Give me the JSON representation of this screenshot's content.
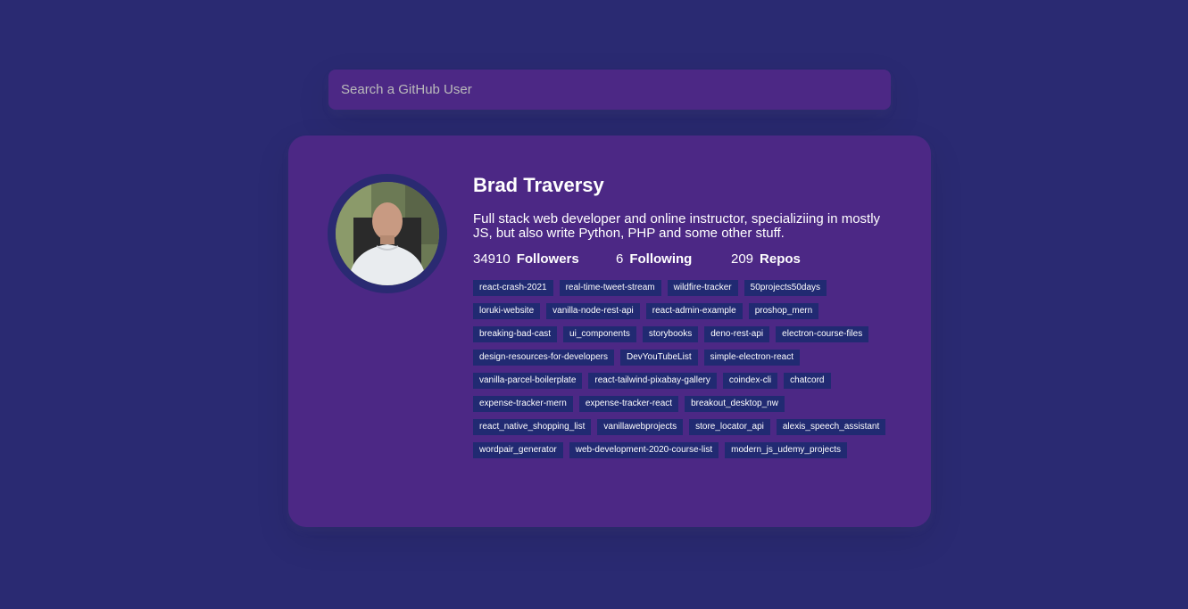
{
  "search": {
    "placeholder": "Search a GitHub User"
  },
  "profile": {
    "name": "Brad Traversy",
    "bio": "Full stack web developer and online instructor, specializiing in mostly JS, but also write Python, PHP and some other stuff.",
    "followers": {
      "count": "34910",
      "label": "Followers"
    },
    "following": {
      "count": "6",
      "label": "Following"
    },
    "repos": {
      "count": "209",
      "label": "Repos"
    }
  },
  "repos": [
    "react-crash-2021",
    "real-time-tweet-stream",
    "wildfire-tracker",
    "50projects50days",
    "loruki-website",
    "vanilla-node-rest-api",
    "react-admin-example",
    "proshop_mern",
    "breaking-bad-cast",
    "ui_components",
    "storybooks",
    "deno-rest-api",
    "electron-course-files",
    "design-resources-for-developers",
    "DevYouTubeList",
    "simple-electron-react",
    "vanilla-parcel-boilerplate",
    "react-tailwind-pixabay-gallery",
    "coindex-cli",
    "chatcord",
    "expense-tracker-mern",
    "expense-tracker-react",
    "breakout_desktop_nw",
    "react_native_shopping_list",
    "vanillawebprojects",
    "store_locator_api",
    "alexis_speech_assistant",
    "wordpair_generator",
    "web-development-2020-course-list",
    "modern_js_udemy_projects"
  ],
  "colors": {
    "background": "#2a2a72",
    "card": "#4c2885",
    "repo_tag": "#212a72",
    "text": "#ffffff"
  }
}
